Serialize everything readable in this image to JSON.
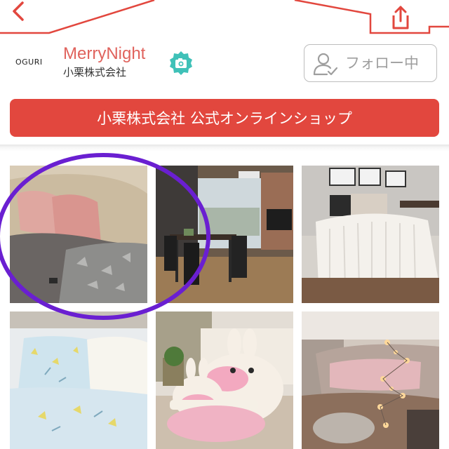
{
  "header": {
    "back_icon": "chevron-left-icon",
    "share_icon": "share-icon",
    "accent_color": "#e2473e"
  },
  "profile": {
    "brand_logo_text": "OGURI",
    "shop_name": "MerryNight",
    "company_name": "小栗株式会社",
    "verified_icon": "camera-badge-icon",
    "follow_button_label": "フォロー中",
    "follow_icon": "user-check-icon"
  },
  "shop_link": {
    "label": "小栗株式会社 公式オンラインショップ",
    "color": "#e2473e"
  },
  "photos": [
    {
      "scene": "grey blanket on sofa with pink cushions"
    },
    {
      "scene": "dining room with black chairs and balcony view"
    },
    {
      "scene": "white bedroom with striped bedding"
    },
    {
      "scene": "floral pillows and blue bedding"
    },
    {
      "scene": "pink bunny plush cushions"
    },
    {
      "scene": "bed with pink blanket and string lights"
    }
  ],
  "annotation": {
    "highlight_color": "#6a1fd1"
  }
}
